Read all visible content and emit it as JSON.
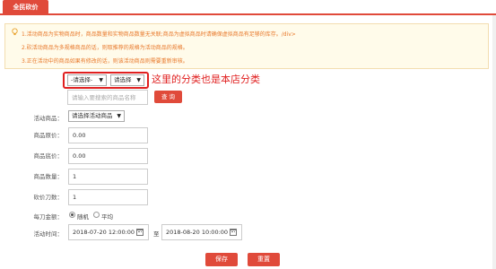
{
  "tabs": [
    {
      "label": "全民砍价"
    }
  ],
  "notice": {
    "lines": [
      "1.活动商品为实物商品时，商品数量和实物商品数量无关联;商品为虚拟商品时请确保虚拟商品有足够的库存。/div>",
      "2.砍活动商品为多规格商品的话，则取推荐的规格为活动商品的规格。",
      "3.正在活动中的商品如果有修改的话，则该活动商品则需要重新审核。"
    ]
  },
  "filter": {
    "category1": "-请选择-",
    "category2": "请选择",
    "search_placeholder": "请输入要搜索的商品名称",
    "query_label": "查 询",
    "annotation": "这里的分类也是本店分类"
  },
  "form": {
    "product_label": "活动商品：",
    "product_select": "请选择活动商品",
    "price_label": "商品原价：",
    "price_value": "0.00",
    "floor_label": "商品底价：",
    "floor_value": "0.00",
    "qty_label": "商品数量：",
    "qty_value": "1",
    "cuts_label": "砍价刀数：",
    "cuts_value": "1",
    "amount_label": "每刀金额：",
    "amount_options": [
      {
        "label": "随机",
        "selected": true
      },
      {
        "label": "平均",
        "selected": false
      }
    ],
    "time_label": "活动时间：",
    "start_time": "2018-07-20 12:00:00",
    "to_label": "至",
    "end_time": "2018-08-20 10:00:00"
  },
  "actions": {
    "save": "保存",
    "reset": "重置"
  },
  "colors": {
    "accent": "#e04a3a",
    "annotation": "#e02020",
    "notice_text": "#e8782a"
  }
}
